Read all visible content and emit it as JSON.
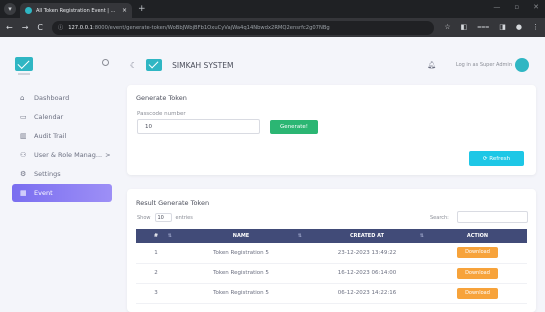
{
  "browser": {
    "tab_title": "All Token Registration Event | ...",
    "tab_close": "×",
    "new_tab": "+",
    "url_host": "127.0.0.1",
    "url_rest": ":8000/event/generate-token/WoBbJWbjBFb1OxuCyVajWa4q14Nbwdx2RMQ2ensrfc2g07NBg"
  },
  "header": {
    "system_name": "SIMKAH SYSTEM",
    "login_as": "Log in as Super Admin"
  },
  "sidebar": {
    "items": [
      {
        "label": "Dashboard",
        "icon": "home-icon"
      },
      {
        "label": "Calendar",
        "icon": "calendar-icon"
      },
      {
        "label": "Audit Trail",
        "icon": "book-icon"
      },
      {
        "label": "User & Role Manag...",
        "icon": "users-icon",
        "chevron": ">"
      },
      {
        "label": "Settings",
        "icon": "gear-icon"
      },
      {
        "label": "Event",
        "icon": "grid-icon",
        "active": true
      }
    ]
  },
  "generate": {
    "title": "Generate Token",
    "label": "Passcode number",
    "value": "10",
    "button": "Generate!",
    "refresh": "⟳ Refresh"
  },
  "result": {
    "title": "Result Generate Token",
    "show": "Show",
    "show_value": "10",
    "entries": "entries",
    "search": "Search:",
    "columns": [
      "#",
      "NAME",
      "CREATED AT",
      "ACTION"
    ],
    "rows": [
      {
        "no": "1",
        "name": "Token Registration 5",
        "created": "23-12-2023 13:49:22",
        "action": "Download"
      },
      {
        "no": "2",
        "name": "Token Registration 5",
        "created": "16-12-2023 06:14:00",
        "action": "Download"
      },
      {
        "no": "3",
        "name": "Token Registration 5",
        "created": "06-12-2023 14:22:16",
        "action": "Download"
      }
    ]
  },
  "colors": {
    "accent": "#7a6ef0",
    "primary_teal": "#2fb6c3",
    "table_header": "#414b78",
    "generate_btn": "#2bb673",
    "refresh_btn": "#1ec7e6",
    "download_btn": "#f7a33b"
  }
}
